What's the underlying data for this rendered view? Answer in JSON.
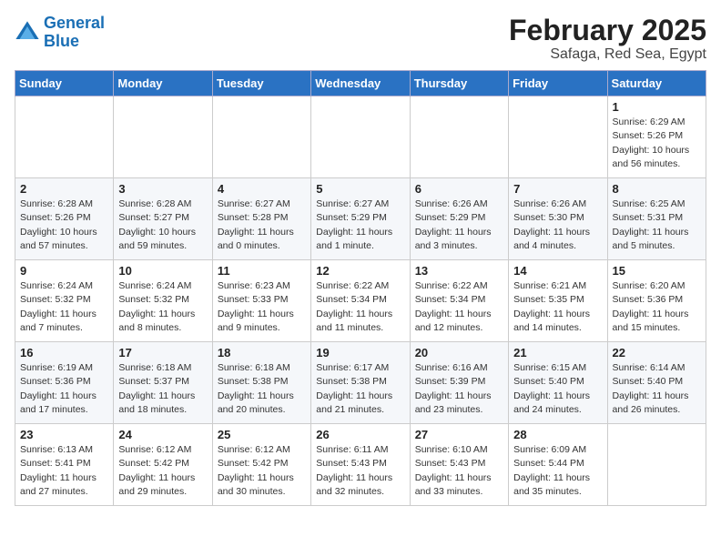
{
  "header": {
    "logo_line1": "General",
    "logo_line2": "Blue",
    "month_year": "February 2025",
    "location": "Safaga, Red Sea, Egypt"
  },
  "days_of_week": [
    "Sunday",
    "Monday",
    "Tuesday",
    "Wednesday",
    "Thursday",
    "Friday",
    "Saturday"
  ],
  "weeks": [
    [
      {
        "day": "",
        "info": ""
      },
      {
        "day": "",
        "info": ""
      },
      {
        "day": "",
        "info": ""
      },
      {
        "day": "",
        "info": ""
      },
      {
        "day": "",
        "info": ""
      },
      {
        "day": "",
        "info": ""
      },
      {
        "day": "1",
        "info": "Sunrise: 6:29 AM\nSunset: 5:26 PM\nDaylight: 10 hours and 56 minutes."
      }
    ],
    [
      {
        "day": "2",
        "info": "Sunrise: 6:28 AM\nSunset: 5:26 PM\nDaylight: 10 hours and 57 minutes."
      },
      {
        "day": "3",
        "info": "Sunrise: 6:28 AM\nSunset: 5:27 PM\nDaylight: 10 hours and 59 minutes."
      },
      {
        "day": "4",
        "info": "Sunrise: 6:27 AM\nSunset: 5:28 PM\nDaylight: 11 hours and 0 minutes."
      },
      {
        "day": "5",
        "info": "Sunrise: 6:27 AM\nSunset: 5:29 PM\nDaylight: 11 hours and 1 minute."
      },
      {
        "day": "6",
        "info": "Sunrise: 6:26 AM\nSunset: 5:29 PM\nDaylight: 11 hours and 3 minutes."
      },
      {
        "day": "7",
        "info": "Sunrise: 6:26 AM\nSunset: 5:30 PM\nDaylight: 11 hours and 4 minutes."
      },
      {
        "day": "8",
        "info": "Sunrise: 6:25 AM\nSunset: 5:31 PM\nDaylight: 11 hours and 5 minutes."
      }
    ],
    [
      {
        "day": "9",
        "info": "Sunrise: 6:24 AM\nSunset: 5:32 PM\nDaylight: 11 hours and 7 minutes."
      },
      {
        "day": "10",
        "info": "Sunrise: 6:24 AM\nSunset: 5:32 PM\nDaylight: 11 hours and 8 minutes."
      },
      {
        "day": "11",
        "info": "Sunrise: 6:23 AM\nSunset: 5:33 PM\nDaylight: 11 hours and 9 minutes."
      },
      {
        "day": "12",
        "info": "Sunrise: 6:22 AM\nSunset: 5:34 PM\nDaylight: 11 hours and 11 minutes."
      },
      {
        "day": "13",
        "info": "Sunrise: 6:22 AM\nSunset: 5:34 PM\nDaylight: 11 hours and 12 minutes."
      },
      {
        "day": "14",
        "info": "Sunrise: 6:21 AM\nSunset: 5:35 PM\nDaylight: 11 hours and 14 minutes."
      },
      {
        "day": "15",
        "info": "Sunrise: 6:20 AM\nSunset: 5:36 PM\nDaylight: 11 hours and 15 minutes."
      }
    ],
    [
      {
        "day": "16",
        "info": "Sunrise: 6:19 AM\nSunset: 5:36 PM\nDaylight: 11 hours and 17 minutes."
      },
      {
        "day": "17",
        "info": "Sunrise: 6:18 AM\nSunset: 5:37 PM\nDaylight: 11 hours and 18 minutes."
      },
      {
        "day": "18",
        "info": "Sunrise: 6:18 AM\nSunset: 5:38 PM\nDaylight: 11 hours and 20 minutes."
      },
      {
        "day": "19",
        "info": "Sunrise: 6:17 AM\nSunset: 5:38 PM\nDaylight: 11 hours and 21 minutes."
      },
      {
        "day": "20",
        "info": "Sunrise: 6:16 AM\nSunset: 5:39 PM\nDaylight: 11 hours and 23 minutes."
      },
      {
        "day": "21",
        "info": "Sunrise: 6:15 AM\nSunset: 5:40 PM\nDaylight: 11 hours and 24 minutes."
      },
      {
        "day": "22",
        "info": "Sunrise: 6:14 AM\nSunset: 5:40 PM\nDaylight: 11 hours and 26 minutes."
      }
    ],
    [
      {
        "day": "23",
        "info": "Sunrise: 6:13 AM\nSunset: 5:41 PM\nDaylight: 11 hours and 27 minutes."
      },
      {
        "day": "24",
        "info": "Sunrise: 6:12 AM\nSunset: 5:42 PM\nDaylight: 11 hours and 29 minutes."
      },
      {
        "day": "25",
        "info": "Sunrise: 6:12 AM\nSunset: 5:42 PM\nDaylight: 11 hours and 30 minutes."
      },
      {
        "day": "26",
        "info": "Sunrise: 6:11 AM\nSunset: 5:43 PM\nDaylight: 11 hours and 32 minutes."
      },
      {
        "day": "27",
        "info": "Sunrise: 6:10 AM\nSunset: 5:43 PM\nDaylight: 11 hours and 33 minutes."
      },
      {
        "day": "28",
        "info": "Sunrise: 6:09 AM\nSunset: 5:44 PM\nDaylight: 11 hours and 35 minutes."
      },
      {
        "day": "",
        "info": ""
      }
    ]
  ]
}
